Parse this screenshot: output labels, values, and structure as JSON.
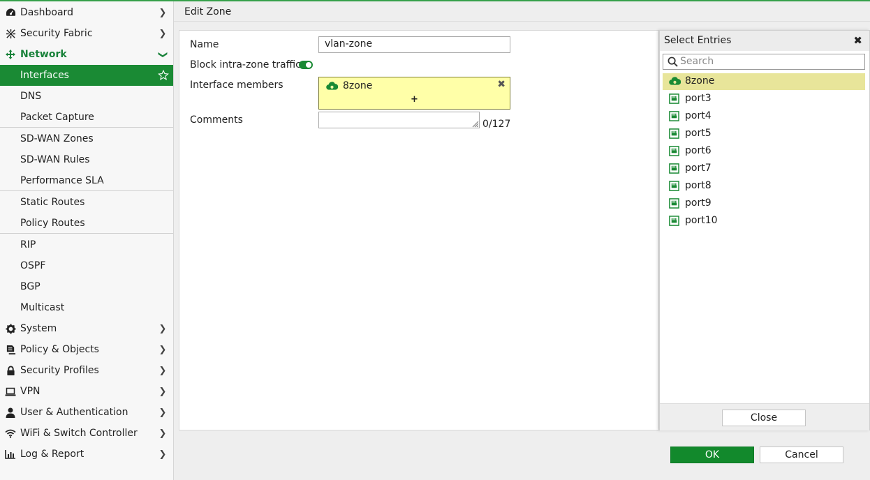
{
  "header": {
    "title": "Edit Zone"
  },
  "sidebar": {
    "items": [
      {
        "label": "Dashboard",
        "icon": "dashboard-icon"
      },
      {
        "label": "Security Fabric",
        "icon": "security-fabric-icon"
      },
      {
        "label": "Network",
        "icon": "network-icon"
      },
      {
        "label": "Interfaces"
      },
      {
        "label": "DNS"
      },
      {
        "label": "Packet Capture"
      },
      {
        "label": "SD-WAN Zones"
      },
      {
        "label": "SD-WAN Rules"
      },
      {
        "label": "Performance SLA"
      },
      {
        "label": "Static Routes"
      },
      {
        "label": "Policy Routes"
      },
      {
        "label": "RIP"
      },
      {
        "label": "OSPF"
      },
      {
        "label": "BGP"
      },
      {
        "label": "Multicast"
      },
      {
        "label": "System",
        "icon": "gear-icon"
      },
      {
        "label": "Policy & Objects",
        "icon": "policy-icon"
      },
      {
        "label": "Security Profiles",
        "icon": "lock-icon"
      },
      {
        "label": "VPN",
        "icon": "laptop-icon"
      },
      {
        "label": "User & Authentication",
        "icon": "user-icon"
      },
      {
        "label": "WiFi & Switch Controller",
        "icon": "wifi-icon"
      },
      {
        "label": "Log & Report",
        "icon": "chart-icon"
      }
    ]
  },
  "form": {
    "name_label": "Name",
    "name_value": "vlan-zone",
    "block_label": "Block intra-zone traffic",
    "block_enabled": true,
    "members_label": "Interface members",
    "members": [
      "8zone"
    ],
    "add_symbol": "+",
    "remove_symbol": "✖",
    "comments_label": "Comments",
    "comments_value": "",
    "comments_counter": "0/127"
  },
  "entries": {
    "title": "Select Entries",
    "close_symbol": "✖",
    "search_placeholder": "Search",
    "items": [
      {
        "label": "8zone",
        "type": "zone",
        "selected": true
      },
      {
        "label": "port3",
        "type": "port"
      },
      {
        "label": "port4",
        "type": "port"
      },
      {
        "label": "port5",
        "type": "port"
      },
      {
        "label": "port6",
        "type": "port"
      },
      {
        "label": "port7",
        "type": "port"
      },
      {
        "label": "port8",
        "type": "port"
      },
      {
        "label": "port9",
        "type": "port"
      },
      {
        "label": "port10",
        "type": "port"
      }
    ],
    "close_label": "Close"
  },
  "actions": {
    "ok_label": "OK",
    "cancel_label": "Cancel"
  },
  "colors": {
    "accent": "#1a8a34",
    "member_bg": "#ffffa8",
    "selected_entry": "#e8e59a"
  }
}
